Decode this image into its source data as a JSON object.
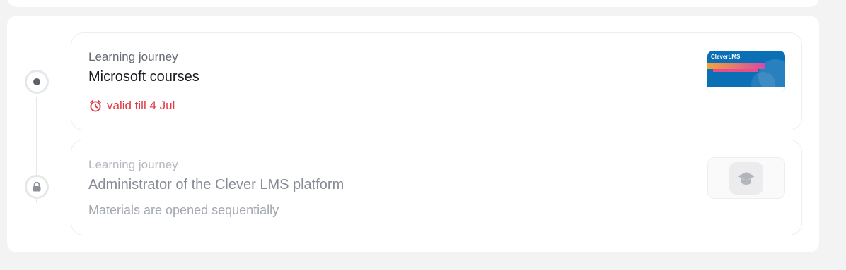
{
  "journeys": [
    {
      "kicker": "Learning journey",
      "title": "Microsoft courses",
      "deadline": "valid till 4 Jul",
      "thumbnail_brand": "CleverLMS",
      "status": "active"
    },
    {
      "kicker": "Learning journey",
      "title": "Administrator of the Clever LMS platform",
      "note": "Materials are opened sequentially",
      "status": "locked"
    }
  ],
  "icons": {
    "active_node": "dot-icon",
    "locked_node": "lock-icon",
    "deadline": "alarm-clock-icon",
    "placeholder": "graduation-cap-icon"
  },
  "colors": {
    "deadline": "#e03a45",
    "node_dot": "#5d6069",
    "thumb_bg": "#0b6fb6"
  }
}
